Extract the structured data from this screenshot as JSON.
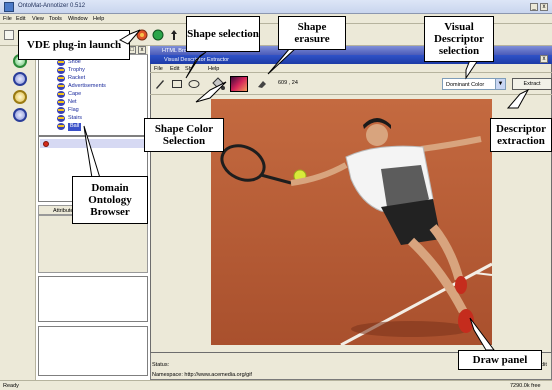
{
  "app": {
    "title": "OntoMat-Annotizer 0.512",
    "menu": [
      "File",
      "Edit",
      "View",
      "Tools",
      "Window",
      "Help"
    ]
  },
  "ontology_tree": {
    "items": [
      "Shoe",
      "Trophy",
      "Racket",
      "Advertisements",
      "Cape",
      "Net",
      "Flag",
      "Stairs",
      "Ball"
    ],
    "selected_index": 8
  },
  "attributes_tab": "Attributes",
  "browser_window": {
    "title": "HTML Bro"
  },
  "vde": {
    "title": "Visual Descriptor Extractor",
    "menu": [
      "File",
      "Edit",
      "Sh",
      "Help"
    ],
    "coords": "609 , 24",
    "descriptor_selected": "Dominant Color",
    "extract_label": "Extract"
  },
  "browser_status": {
    "status_label": "Status:",
    "namespace": "Namespace: http://www.acemedia.org/gif",
    "edit_label": "edit"
  },
  "statusbar": {
    "left": "Ready",
    "right": "7290.0k free"
  },
  "callouts": {
    "vde_launch": "VDE plug-in launch",
    "shape_selection": "Shape selection",
    "shape_erasure": "Shape erasure",
    "visual_descriptor_selection": "Visual Descriptor selection",
    "shape_color_selection": "Shape Color Selection",
    "descriptor_extraction": "Descriptor extraction",
    "domain_ontology_browser": "Domain Ontology Browser",
    "draw_panel": "Draw panel"
  },
  "colors": {
    "callout_border": "#000000",
    "title_active": "#1d3aa6",
    "court": "#b45a35"
  },
  "icons": [
    "plugin-launch-icon",
    "pen-icon",
    "rectangle-icon",
    "ellipse-icon",
    "paint-bucket-icon",
    "color-swatch-icon",
    "eraser-icon"
  ]
}
